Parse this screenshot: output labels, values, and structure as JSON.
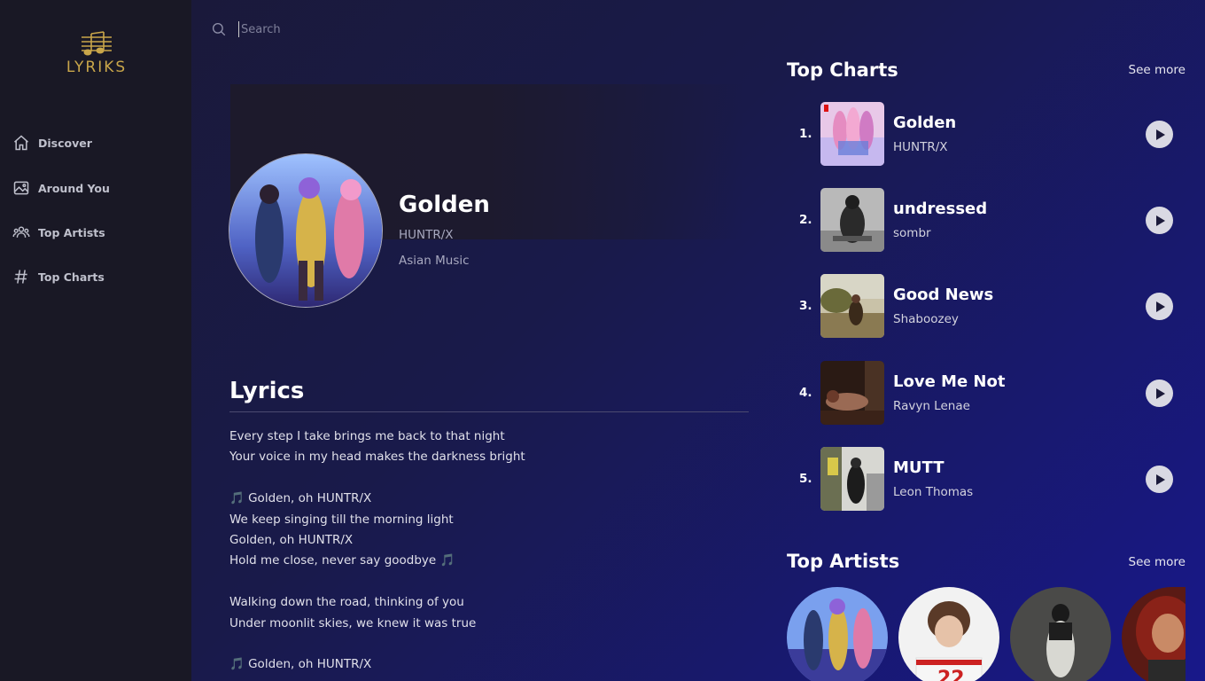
{
  "app": {
    "logo_text": "LYRIKS"
  },
  "sidebar": {
    "items": [
      {
        "label": "Discover",
        "icon": "home-icon"
      },
      {
        "label": "Around You",
        "icon": "image-icon"
      },
      {
        "label": "Top Artists",
        "icon": "users-icon"
      },
      {
        "label": "Top Charts",
        "icon": "hash-icon"
      }
    ]
  },
  "search": {
    "placeholder": "Search",
    "value": ""
  },
  "song": {
    "title": "Golden",
    "artist": "HUNTR/X",
    "genre": "Asian Music"
  },
  "lyrics": {
    "heading": "Lyrics",
    "lines": [
      "Every step I take brings me back to that night",
      "Your voice in my head makes the darkness bright",
      "",
      "🎵 Golden, oh HUNTR/X",
      "We keep singing till the morning light",
      "Golden, oh HUNTR/X",
      "Hold me close, never say goodbye 🎵",
      "",
      "Walking down the road, thinking of you",
      "Under moonlit skies, we knew it was true",
      "",
      "🎵 Golden, oh HUNTR/X"
    ]
  },
  "top_charts": {
    "heading": "Top Charts",
    "see_more": "See more",
    "items": [
      {
        "rank": "1.",
        "title": "Golden",
        "artist": "HUNTR/X"
      },
      {
        "rank": "2.",
        "title": "undressed",
        "artist": "sombr"
      },
      {
        "rank": "3.",
        "title": "Good News",
        "artist": "Shaboozey"
      },
      {
        "rank": "4.",
        "title": "Love Me Not",
        "artist": "Ravyn Lenae"
      },
      {
        "rank": "5.",
        "title": "MUTT",
        "artist": "Leon Thomas"
      }
    ]
  },
  "top_artists": {
    "heading": "Top Artists",
    "see_more": "See more"
  },
  "colors": {
    "accent_gold": "#c9a64a",
    "sidebar_bg": "#191825",
    "muted_text": "#a7a8bf"
  }
}
